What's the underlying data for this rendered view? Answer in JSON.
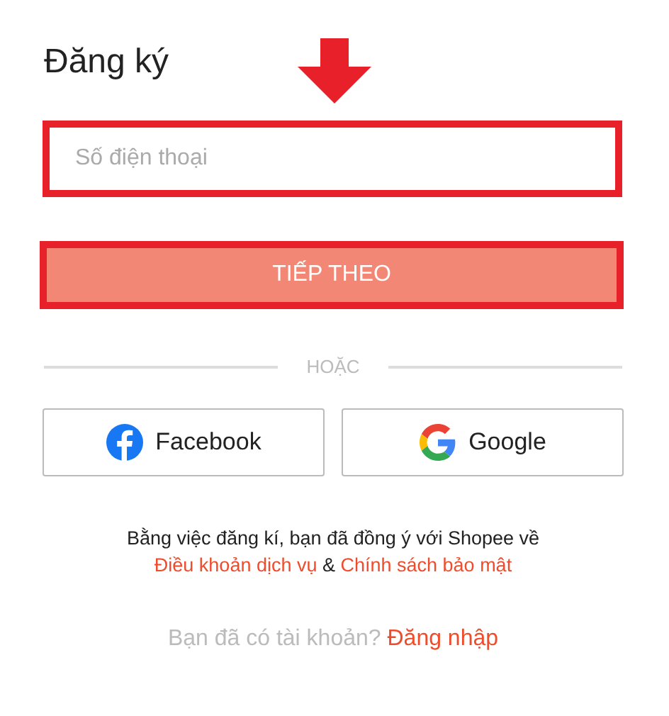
{
  "title": "Đăng ký",
  "phone_field": {
    "placeholder": "Số điện thoại",
    "highlighted": true
  },
  "next_button": {
    "label": "TIẾP THEO",
    "highlighted": true,
    "disabled": true
  },
  "divider_label": "HOẶC",
  "social_buttons": [
    {
      "kind": "facebook",
      "label": "Facebook"
    },
    {
      "kind": "google",
      "label": "Google"
    }
  ],
  "terms": {
    "text": "Bằng việc đăng kí, bạn đã đồng ý với Shopee về",
    "link_1": "Điều khoản dịch vụ",
    "separator": "&",
    "link_2": "Chính sách bảo mật"
  },
  "login_prompt": {
    "text": "Bạn đã có tài khoản?",
    "link": "Đăng nhập"
  }
}
